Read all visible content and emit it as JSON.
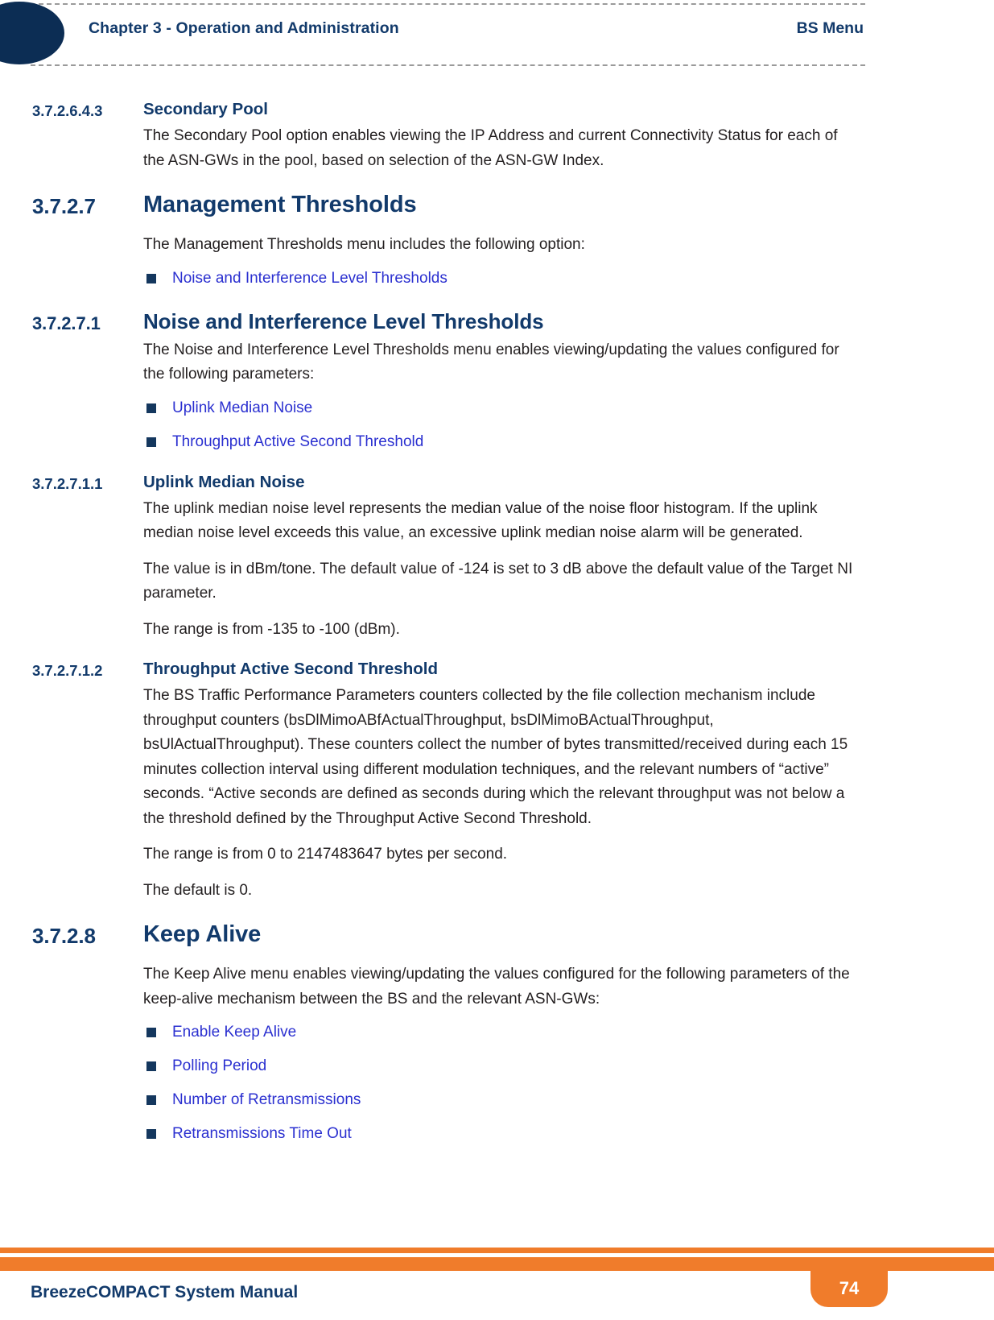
{
  "header": {
    "chapter": "Chapter 3 - Operation and Administration",
    "section": "BS Menu"
  },
  "footer": {
    "manual_title": "BreezeCOMPACT System Manual",
    "page_number": "74"
  },
  "colors": {
    "navy": "#123a6b",
    "dark_navy": "#0c2d54",
    "link_blue": "#2b30d0",
    "orange": "#f07c2b",
    "bullet_navy": "#14375e",
    "body_text": "#231f20",
    "dashed_rule": "#9a9a9a"
  },
  "sections": {
    "secondary_pool": {
      "number": "3.7.2.6.4.3",
      "title": "Secondary Pool",
      "paragraph": "The Secondary Pool option enables viewing the IP Address and current Connectivity Status for each of the ASN-GWs in the pool, based on selection of the ASN-GW Index."
    },
    "management_thresholds": {
      "number": "3.7.2.7",
      "title": "Management Thresholds",
      "paragraph": "The Management Thresholds menu includes the following option:",
      "bullets": [
        "Noise and Interference Level Thresholds"
      ]
    },
    "noise_interference": {
      "number": "3.7.2.7.1",
      "title": "Noise and Interference Level Thresholds",
      "paragraph": "The Noise and Interference Level Thresholds menu enables viewing/updating the values configured for the following parameters:",
      "bullets": [
        "Uplink Median Noise",
        "Throughput Active Second Threshold"
      ]
    },
    "uplink_median_noise": {
      "number": "3.7.2.7.1.1",
      "title": "Uplink Median Noise",
      "paragraph_1": "The uplink median noise level represents the median value of the noise floor histogram. If the uplink median noise level exceeds this value, an excessive uplink median noise alarm will be generated.",
      "paragraph_2": "The value is in dBm/tone. The default value of -124 is set to 3 dB above the default value of the Target NI parameter.",
      "paragraph_3": "The range is from -135 to -100 (dBm)."
    },
    "throughput_active_second": {
      "number": "3.7.2.7.1.2",
      "title": "Throughput Active Second Threshold",
      "paragraph_1": "The BS Traffic Performance Parameters counters collected by the file collection mechanism include throughput counters (bsDlMimoABfActualThroughput, bsDlMimoBActualThroughput, bsUlActualThroughput). These counters collect the number of bytes transmitted/received during each 15 minutes collection interval using different modulation techniques, and the relevant numbers of “active” seconds. “Active seconds are defined as seconds during which the relevant throughput was not below a the threshold defined by the Throughput Active Second Threshold.",
      "paragraph_2": "The range is from 0 to 2147483647 bytes per second.",
      "paragraph_3": "The default is 0."
    },
    "keep_alive": {
      "number": "3.7.2.8",
      "title": "Keep Alive",
      "paragraph": "The Keep Alive menu enables viewing/updating the values configured for the following parameters of the keep-alive mechanism between the BS and the relevant ASN-GWs:",
      "bullets": [
        "Enable Keep Alive",
        "Polling Period",
        "Number of Retransmissions",
        "Retransmissions Time Out"
      ]
    }
  }
}
